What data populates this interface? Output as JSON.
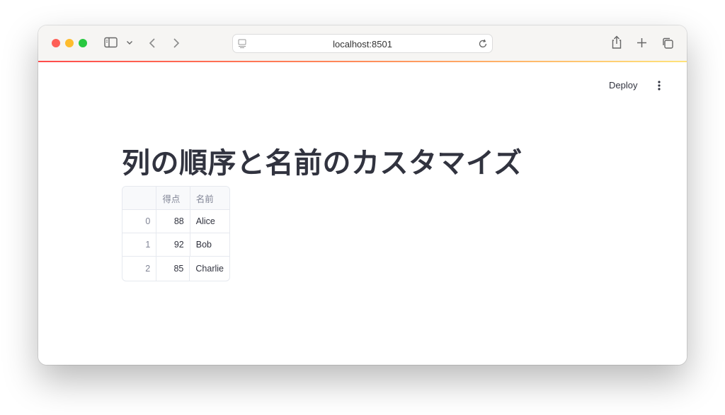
{
  "browser": {
    "url": "localhost:8501"
  },
  "toolbar": {
    "deploy_label": "Deploy"
  },
  "main": {
    "title": "列の順序と名前のカスタマイズ"
  },
  "table": {
    "headers": [
      "",
      "得点",
      "名前"
    ],
    "rows": [
      {
        "index": "0",
        "score": "88",
        "name": "Alice"
      },
      {
        "index": "1",
        "score": "92",
        "name": "Bob"
      },
      {
        "index": "2",
        "score": "85",
        "name": "Charlie"
      }
    ]
  },
  "colors": {
    "accent_start": "#ff4b4b",
    "accent_end": "#ffe37a",
    "text": "#31333f",
    "muted": "#808495"
  }
}
